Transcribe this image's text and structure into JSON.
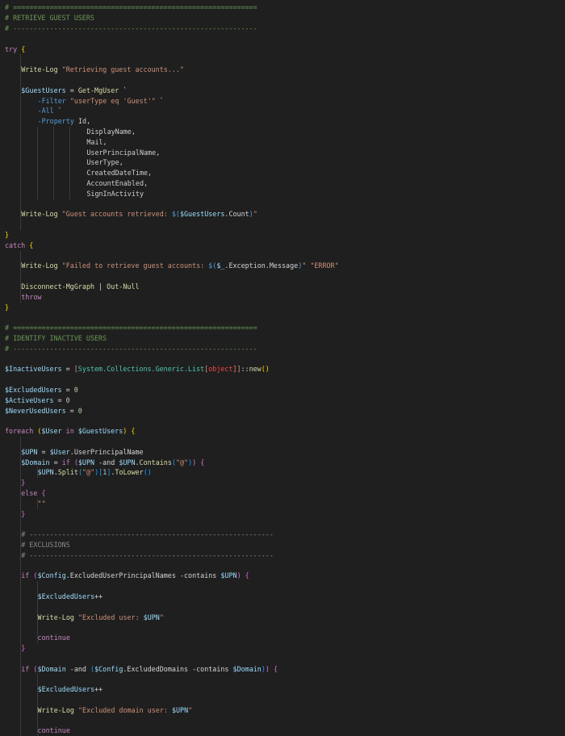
{
  "editor": {
    "colors": {
      "background": "#1f1f1f",
      "comment": "#6a9955",
      "keyword": "#c586c0",
      "function": "#dcdcaa",
      "string": "#ce9178",
      "variable": "#9cdcfe",
      "number": "#b5cea8",
      "bracket_gold": "#ffd700"
    },
    "lines": [
      {
        "y": 0,
        "indent": 0,
        "tokens": [
          [
            "t-com",
            "# ============================================================"
          ]
        ]
      },
      {
        "y": 1,
        "indent": 0,
        "tokens": [
          [
            "t-com",
            "# RETRIEVE GUEST USERS"
          ]
        ]
      },
      {
        "y": 2,
        "indent": 0,
        "tokens": [
          [
            "t-com",
            "# ------------------------------------------------------------"
          ]
        ]
      },
      {
        "y": 4,
        "indent": 0,
        "tokens": [
          [
            "t-kw",
            "try"
          ],
          [
            "t-plain",
            " "
          ],
          [
            "t-br1",
            "{"
          ]
        ]
      },
      {
        "y": 6,
        "indent": 4,
        "tokens": [
          [
            "t-fn",
            "Write-Log"
          ],
          [
            "t-plain",
            " "
          ],
          [
            "t-str",
            "\"Retrieving guest accounts...\""
          ]
        ]
      },
      {
        "y": 8,
        "indent": 4,
        "tokens": [
          [
            "t-var",
            "$GuestUsers"
          ],
          [
            "t-op",
            " = "
          ],
          [
            "t-fn",
            "Get-MgUser"
          ],
          [
            "t-plain",
            " `"
          ]
        ]
      },
      {
        "y": 9,
        "indent": 8,
        "tokens": [
          [
            "t-kwb",
            "-Filter"
          ],
          [
            "t-plain",
            " "
          ],
          [
            "t-str",
            "\"userType eq 'Guest'\""
          ],
          [
            "t-plain",
            " `"
          ]
        ]
      },
      {
        "y": 10,
        "indent": 8,
        "tokens": [
          [
            "t-kwb",
            "-All"
          ],
          [
            "t-plain",
            " `"
          ]
        ]
      },
      {
        "y": 11,
        "indent": 8,
        "tokens": [
          [
            "t-kwb",
            "-Property"
          ],
          [
            "t-prop",
            " Id,"
          ]
        ]
      },
      {
        "y": 12,
        "indent": 20,
        "tokens": [
          [
            "t-prop",
            "DisplayName,"
          ]
        ]
      },
      {
        "y": 13,
        "indent": 20,
        "tokens": [
          [
            "t-prop",
            "Mail,"
          ]
        ]
      },
      {
        "y": 14,
        "indent": 20,
        "tokens": [
          [
            "t-prop",
            "UserPrincipalName,"
          ]
        ]
      },
      {
        "y": 15,
        "indent": 20,
        "tokens": [
          [
            "t-prop",
            "UserType,"
          ]
        ]
      },
      {
        "y": 16,
        "indent": 20,
        "tokens": [
          [
            "t-prop",
            "CreatedDateTime,"
          ]
        ]
      },
      {
        "y": 17,
        "indent": 20,
        "tokens": [
          [
            "t-prop",
            "AccountEnabled,"
          ]
        ]
      },
      {
        "y": 18,
        "indent": 20,
        "tokens": [
          [
            "t-prop",
            "SignInActivity"
          ]
        ]
      },
      {
        "y": 20,
        "indent": 4,
        "tokens": [
          [
            "t-fn",
            "Write-Log"
          ],
          [
            "t-plain",
            " "
          ],
          [
            "t-str",
            "\"Guest accounts retrieved: "
          ],
          [
            "t-kwb",
            "$("
          ],
          [
            "t-var",
            "$GuestUsers"
          ],
          [
            "t-op",
            "."
          ],
          [
            "t-plain",
            "Count"
          ],
          [
            "t-kwb",
            ")"
          ],
          [
            "t-str",
            "\""
          ]
        ]
      },
      {
        "y": 22,
        "indent": 0,
        "tokens": [
          [
            "t-br1",
            "}"
          ]
        ]
      },
      {
        "y": 23,
        "indent": 0,
        "tokens": [
          [
            "t-kw",
            "catch"
          ],
          [
            "t-plain",
            " "
          ],
          [
            "t-br1",
            "{"
          ]
        ]
      },
      {
        "y": 25,
        "indent": 4,
        "tokens": [
          [
            "t-fn",
            "Write-Log"
          ],
          [
            "t-plain",
            " "
          ],
          [
            "t-str",
            "\"Failed to retrieve guest accounts: "
          ],
          [
            "t-kwb",
            "$("
          ],
          [
            "t-var",
            "$_"
          ],
          [
            "t-op",
            "."
          ],
          [
            "t-plain",
            "Exception.Message"
          ],
          [
            "t-kwb",
            ")"
          ],
          [
            "t-str",
            "\""
          ],
          [
            "t-plain",
            " "
          ],
          [
            "t-str",
            "\"ERROR\""
          ]
        ]
      },
      {
        "y": 27,
        "indent": 4,
        "tokens": [
          [
            "t-fn",
            "Disconnect-MgGraph"
          ],
          [
            "t-op",
            " | "
          ],
          [
            "t-fn",
            "Out-Null"
          ]
        ]
      },
      {
        "y": 28,
        "indent": 4,
        "tokens": [
          [
            "t-kw",
            "throw"
          ]
        ]
      },
      {
        "y": 29,
        "indent": 0,
        "tokens": [
          [
            "t-br1",
            "}"
          ]
        ]
      },
      {
        "y": 31,
        "indent": 0,
        "tokens": [
          [
            "t-com",
            "# ============================================================"
          ]
        ]
      },
      {
        "y": 32,
        "indent": 0,
        "tokens": [
          [
            "t-com",
            "# IDENTIFY INACTIVE USERS"
          ]
        ]
      },
      {
        "y": 33,
        "indent": 0,
        "tokens": [
          [
            "t-com",
            "# ------------------------------------------------------------"
          ]
        ]
      },
      {
        "y": 35,
        "indent": 0,
        "tokens": [
          [
            "t-var",
            "$InactiveUsers"
          ],
          [
            "t-op",
            " = "
          ],
          [
            "t-str",
            "["
          ],
          [
            "t-cls",
            "System.Collections.Generic.List"
          ],
          [
            "t-str",
            "["
          ],
          [
            "t-type",
            "object"
          ],
          [
            "t-str",
            "]]"
          ],
          [
            "t-op",
            "::"
          ],
          [
            "t-fn",
            "new"
          ],
          [
            "t-br1",
            "()"
          ]
        ]
      },
      {
        "y": 37,
        "indent": 0,
        "tokens": [
          [
            "t-var",
            "$ExcludedUsers"
          ],
          [
            "t-op",
            " = "
          ],
          [
            "t-num",
            "0"
          ]
        ]
      },
      {
        "y": 38,
        "indent": 0,
        "tokens": [
          [
            "t-var",
            "$ActiveUsers"
          ],
          [
            "t-op",
            " = "
          ],
          [
            "t-num",
            "0"
          ]
        ]
      },
      {
        "y": 39,
        "indent": 0,
        "tokens": [
          [
            "t-var",
            "$NeverUsedUsers"
          ],
          [
            "t-op",
            " = "
          ],
          [
            "t-num",
            "0"
          ]
        ]
      },
      {
        "y": 41,
        "indent": 0,
        "tokens": [
          [
            "t-kw",
            "foreach"
          ],
          [
            "t-plain",
            " "
          ],
          [
            "t-br1",
            "("
          ],
          [
            "t-var",
            "$User"
          ],
          [
            "t-plain",
            " "
          ],
          [
            "t-kw",
            "in"
          ],
          [
            "t-plain",
            " "
          ],
          [
            "t-var",
            "$GuestUsers"
          ],
          [
            "t-br1",
            ")"
          ],
          [
            "t-plain",
            " "
          ],
          [
            "t-br1",
            "{"
          ]
        ]
      },
      {
        "y": 43,
        "indent": 4,
        "tokens": [
          [
            "t-var",
            "$UPN"
          ],
          [
            "t-op",
            " = "
          ],
          [
            "t-var",
            "$User"
          ],
          [
            "t-op",
            "."
          ],
          [
            "t-plain",
            "UserPrincipalName"
          ]
        ]
      },
      {
        "y": 44,
        "indent": 4,
        "tokens": [
          [
            "t-var",
            "$Domain"
          ],
          [
            "t-op",
            " = "
          ],
          [
            "t-kw",
            "if"
          ],
          [
            "t-plain",
            " "
          ],
          [
            "t-br2",
            "("
          ],
          [
            "t-var",
            "$UPN"
          ],
          [
            "t-plain",
            " "
          ],
          [
            "t-op",
            "-and"
          ],
          [
            "t-plain",
            " "
          ],
          [
            "t-var",
            "$UPN"
          ],
          [
            "t-op",
            "."
          ],
          [
            "t-fn",
            "Contains"
          ],
          [
            "t-br3",
            "("
          ],
          [
            "t-str",
            "\"@\""
          ],
          [
            "t-br3",
            ")"
          ],
          [
            "t-br2",
            ")"
          ],
          [
            "t-plain",
            " "
          ],
          [
            "t-br2",
            "{"
          ]
        ]
      },
      {
        "y": 45,
        "indent": 8,
        "tokens": [
          [
            "t-var",
            "$UPN"
          ],
          [
            "t-op",
            "."
          ],
          [
            "t-fn",
            "Split"
          ],
          [
            "t-br3",
            "("
          ],
          [
            "t-str",
            "\"@\""
          ],
          [
            "t-br3",
            ")"
          ],
          [
            "t-br3",
            "["
          ],
          [
            "t-num",
            "1"
          ],
          [
            "t-br3",
            "]"
          ],
          [
            "t-op",
            "."
          ],
          [
            "t-fn",
            "ToLower"
          ],
          [
            "t-br3",
            "()"
          ]
        ]
      },
      {
        "y": 46,
        "indent": 4,
        "tokens": [
          [
            "t-br2",
            "}"
          ]
        ]
      },
      {
        "y": 47,
        "indent": 4,
        "tokens": [
          [
            "t-kw",
            "else"
          ],
          [
            "t-plain",
            " "
          ],
          [
            "t-br2",
            "{"
          ]
        ]
      },
      {
        "y": 48,
        "indent": 8,
        "tokens": [
          [
            "t-str",
            "\"\""
          ]
        ]
      },
      {
        "y": 49,
        "indent": 4,
        "tokens": [
          [
            "t-br2",
            "}"
          ]
        ]
      },
      {
        "y": 51,
        "indent": 4,
        "tokens": [
          [
            "t-comd",
            "# ------------------------------------------------------------"
          ]
        ]
      },
      {
        "y": 52,
        "indent": 4,
        "tokens": [
          [
            "t-comd",
            "# EXCLUSIONS"
          ]
        ]
      },
      {
        "y": 53,
        "indent": 4,
        "tokens": [
          [
            "t-comd",
            "# ------------------------------------------------------------"
          ]
        ]
      },
      {
        "y": 55,
        "indent": 4,
        "tokens": [
          [
            "t-kw",
            "if"
          ],
          [
            "t-plain",
            " "
          ],
          [
            "t-br2",
            "("
          ],
          [
            "t-var",
            "$Config"
          ],
          [
            "t-op",
            "."
          ],
          [
            "t-plain",
            "ExcludedUserPrincipalNames"
          ],
          [
            "t-plain",
            " "
          ],
          [
            "t-op",
            "-contains"
          ],
          [
            "t-plain",
            " "
          ],
          [
            "t-var",
            "$UPN"
          ],
          [
            "t-br2",
            ")"
          ],
          [
            "t-plain",
            " "
          ],
          [
            "t-br2",
            "{"
          ]
        ]
      },
      {
        "y": 57,
        "indent": 8,
        "tokens": [
          [
            "t-var",
            "$ExcludedUsers"
          ],
          [
            "t-op",
            "++"
          ]
        ]
      },
      {
        "y": 59,
        "indent": 8,
        "tokens": [
          [
            "t-fn",
            "Write-Log"
          ],
          [
            "t-plain",
            " "
          ],
          [
            "t-str",
            "\"Excluded user: "
          ],
          [
            "t-var",
            "$UPN"
          ],
          [
            "t-str",
            "\""
          ]
        ]
      },
      {
        "y": 61,
        "indent": 8,
        "tokens": [
          [
            "t-kw",
            "continue"
          ]
        ]
      },
      {
        "y": 62,
        "indent": 4,
        "tokens": [
          [
            "t-br2",
            "}"
          ]
        ]
      },
      {
        "y": 64,
        "indent": 4,
        "tokens": [
          [
            "t-kw",
            "if"
          ],
          [
            "t-plain",
            " "
          ],
          [
            "t-br2",
            "("
          ],
          [
            "t-var",
            "$Domain"
          ],
          [
            "t-plain",
            " "
          ],
          [
            "t-op",
            "-and"
          ],
          [
            "t-plain",
            " "
          ],
          [
            "t-br3",
            "("
          ],
          [
            "t-var",
            "$Config"
          ],
          [
            "t-op",
            "."
          ],
          [
            "t-plain",
            "ExcludedDomains"
          ],
          [
            "t-plain",
            " "
          ],
          [
            "t-op",
            "-contains"
          ],
          [
            "t-plain",
            " "
          ],
          [
            "t-var",
            "$Domain"
          ],
          [
            "t-br3",
            ")"
          ],
          [
            "t-br2",
            ")"
          ],
          [
            "t-plain",
            " "
          ],
          [
            "t-br2",
            "{"
          ]
        ]
      },
      {
        "y": 66,
        "indent": 8,
        "tokens": [
          [
            "t-var",
            "$ExcludedUsers"
          ],
          [
            "t-op",
            "++"
          ]
        ]
      },
      {
        "y": 68,
        "indent": 8,
        "tokens": [
          [
            "t-fn",
            "Write-Log"
          ],
          [
            "t-plain",
            " "
          ],
          [
            "t-str",
            "\"Excluded domain user: "
          ],
          [
            "t-var",
            "$UPN"
          ],
          [
            "t-str",
            "\""
          ]
        ]
      },
      {
        "y": 70,
        "indent": 8,
        "tokens": [
          [
            "t-kw",
            "continue"
          ]
        ]
      }
    ],
    "guides": [
      {
        "col": 4,
        "from": 5,
        "to": 21
      },
      {
        "col": 8,
        "from": 12,
        "to": 18
      },
      {
        "col": 12,
        "from": 12,
        "to": 18
      },
      {
        "col": 16,
        "from": 12,
        "to": 18
      },
      {
        "col": 4,
        "from": 24,
        "to": 28
      },
      {
        "col": 4,
        "from": 42,
        "to": 70
      },
      {
        "col": 8,
        "from": 45,
        "to": 45
      },
      {
        "col": 8,
        "from": 48,
        "to": 48
      },
      {
        "col": 8,
        "from": 56,
        "to": 61
      },
      {
        "col": 8,
        "from": 65,
        "to": 70
      }
    ]
  }
}
